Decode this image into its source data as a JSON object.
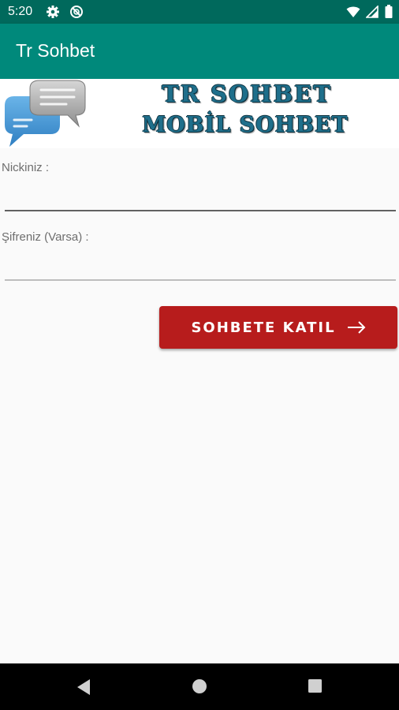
{
  "status_bar": {
    "time": "5:20",
    "left_icons": [
      "gear-icon",
      "no-disturb-icon"
    ],
    "right_icons": [
      "wifi-icon",
      "signal-icon",
      "battery-icon"
    ]
  },
  "app_bar": {
    "title": "Tr Sohbet"
  },
  "banner": {
    "line1": "TR SOHBET",
    "line2": "MOBİL SOHBET",
    "icon": "chat-bubbles-icon"
  },
  "form": {
    "nick_label": "Nickiniz :",
    "nick_value": "",
    "password_label": "Şifreniz (Varsa) :",
    "password_value": "",
    "join_button_label": "SOHBETE KATIL",
    "join_button_icon": "arrow-right-icon"
  },
  "nav_bar": {
    "buttons": [
      "back-icon",
      "home-icon",
      "recents-icon"
    ]
  },
  "colors": {
    "status_bar": "#00695c",
    "app_bar": "#00897b",
    "button": "#b71c1c",
    "banner_text": "#1f6f8b",
    "background": "#fafafa"
  }
}
